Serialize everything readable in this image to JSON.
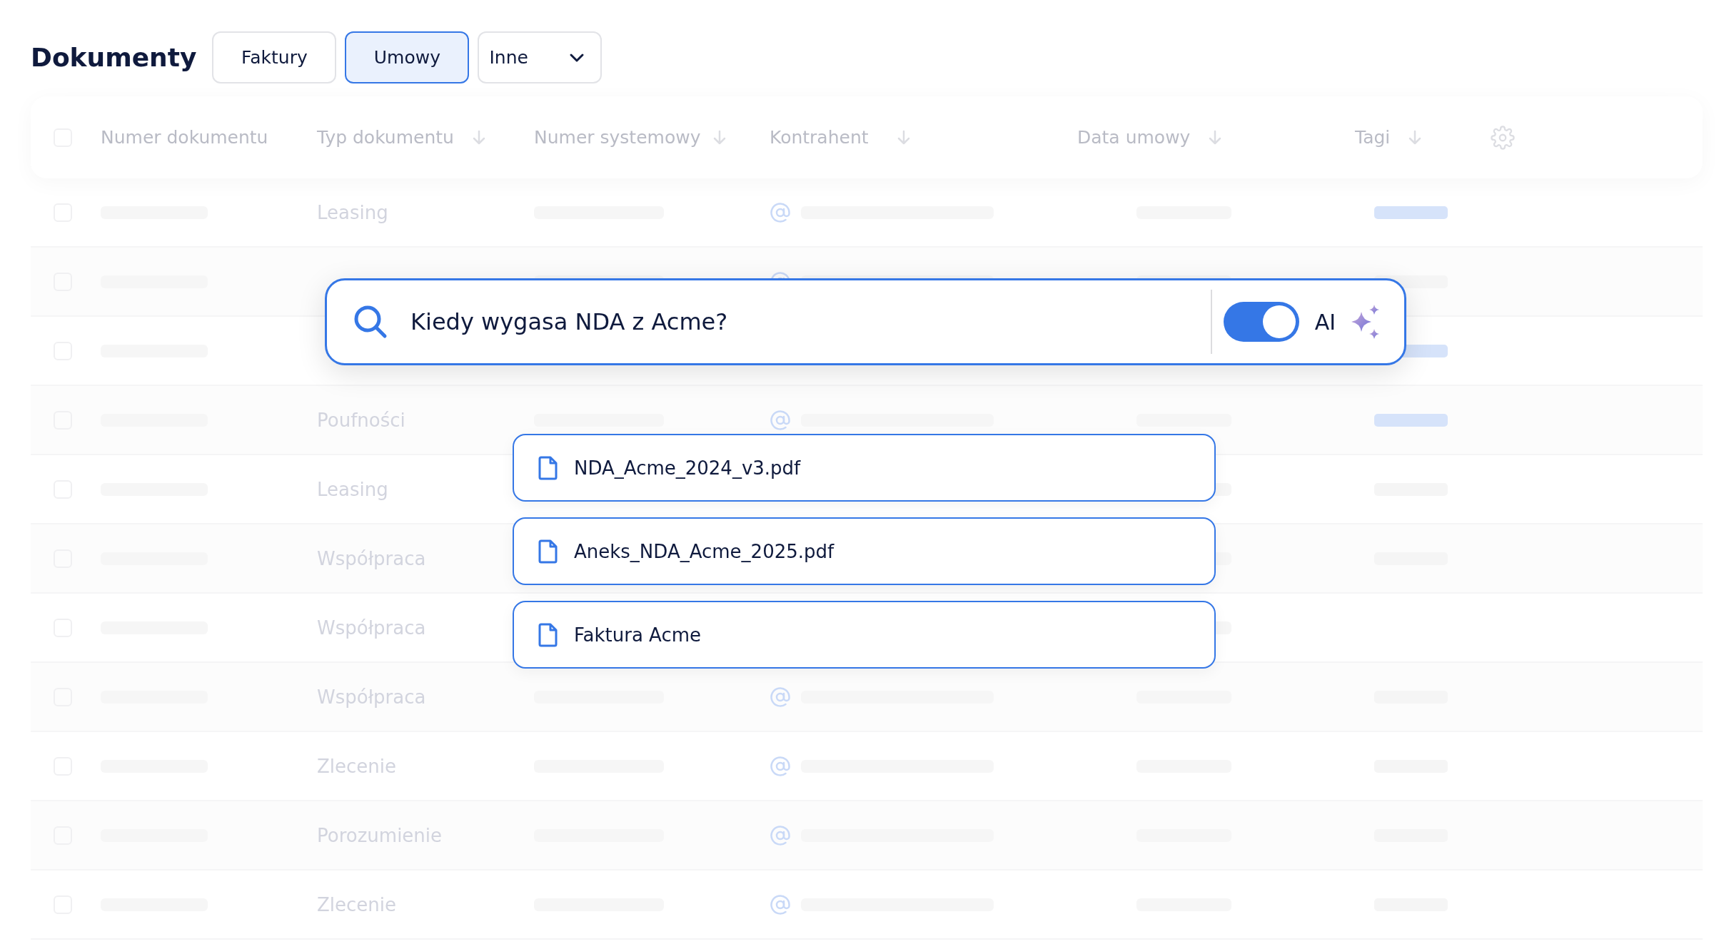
{
  "title": "Dokumenty",
  "tabs": [
    {
      "label": "Faktury",
      "selected": false,
      "kind": "tab"
    },
    {
      "label": "Umowy",
      "selected": true,
      "kind": "tab"
    },
    {
      "label": "Inne",
      "selected": false,
      "kind": "dropdown"
    }
  ],
  "table": {
    "all_checked": false,
    "columns": [
      {
        "label": "Numer dokumentu",
        "sortable": false
      },
      {
        "label": "Typ dokumentu",
        "sortable": true
      },
      {
        "label": "Numer systemowy",
        "sortable": true
      },
      {
        "label": "Kontrahent",
        "sortable": true
      },
      {
        "label": "Data umowy",
        "sortable": true
      },
      {
        "label": "Tagi",
        "sortable": true
      }
    ],
    "rows": [
      {
        "type": "Leasing",
        "checked": false,
        "tag": {
          "color": "#d6e3fa"
        }
      },
      {
        "checked": false,
        "tag": {
          "color": "#f5f5f5"
        }
      },
      {
        "checked": false,
        "tag": {
          "color": "#d6e3fa"
        }
      },
      {
        "type": "Poufności",
        "checked": false,
        "tag": {
          "color": "#d6e3fa"
        }
      },
      {
        "type": "Leasing",
        "checked": false,
        "tag": {
          "color": "#f5f5f5"
        }
      },
      {
        "type": "Współpraca",
        "checked": false,
        "tag": {
          "color": "#f5f5f5"
        }
      },
      {
        "type": "Współpraca",
        "checked": false
      },
      {
        "type": "Współpraca",
        "checked": false,
        "tag": {
          "color": "#f5f5f5"
        }
      },
      {
        "type": "Zlecenie",
        "checked": false,
        "tag": {
          "color": "#f5f5f5"
        }
      },
      {
        "type": "Porozumienie",
        "checked": false,
        "tag": {
          "color": "#f5f5f5"
        }
      },
      {
        "type": "Zlecenie",
        "checked": false,
        "tag": {
          "color": "#f5f5f5"
        }
      }
    ]
  },
  "search": {
    "value": "Kiedy wygasa NDA z Acme?",
    "ai_on": true,
    "ai_label": "AI"
  },
  "results": [
    {
      "name": "NDA_Acme_2024_v3.pdf"
    },
    {
      "name": "Aneks_NDA_Acme_2025.pdf"
    },
    {
      "name": "Faktura Acme"
    }
  ]
}
